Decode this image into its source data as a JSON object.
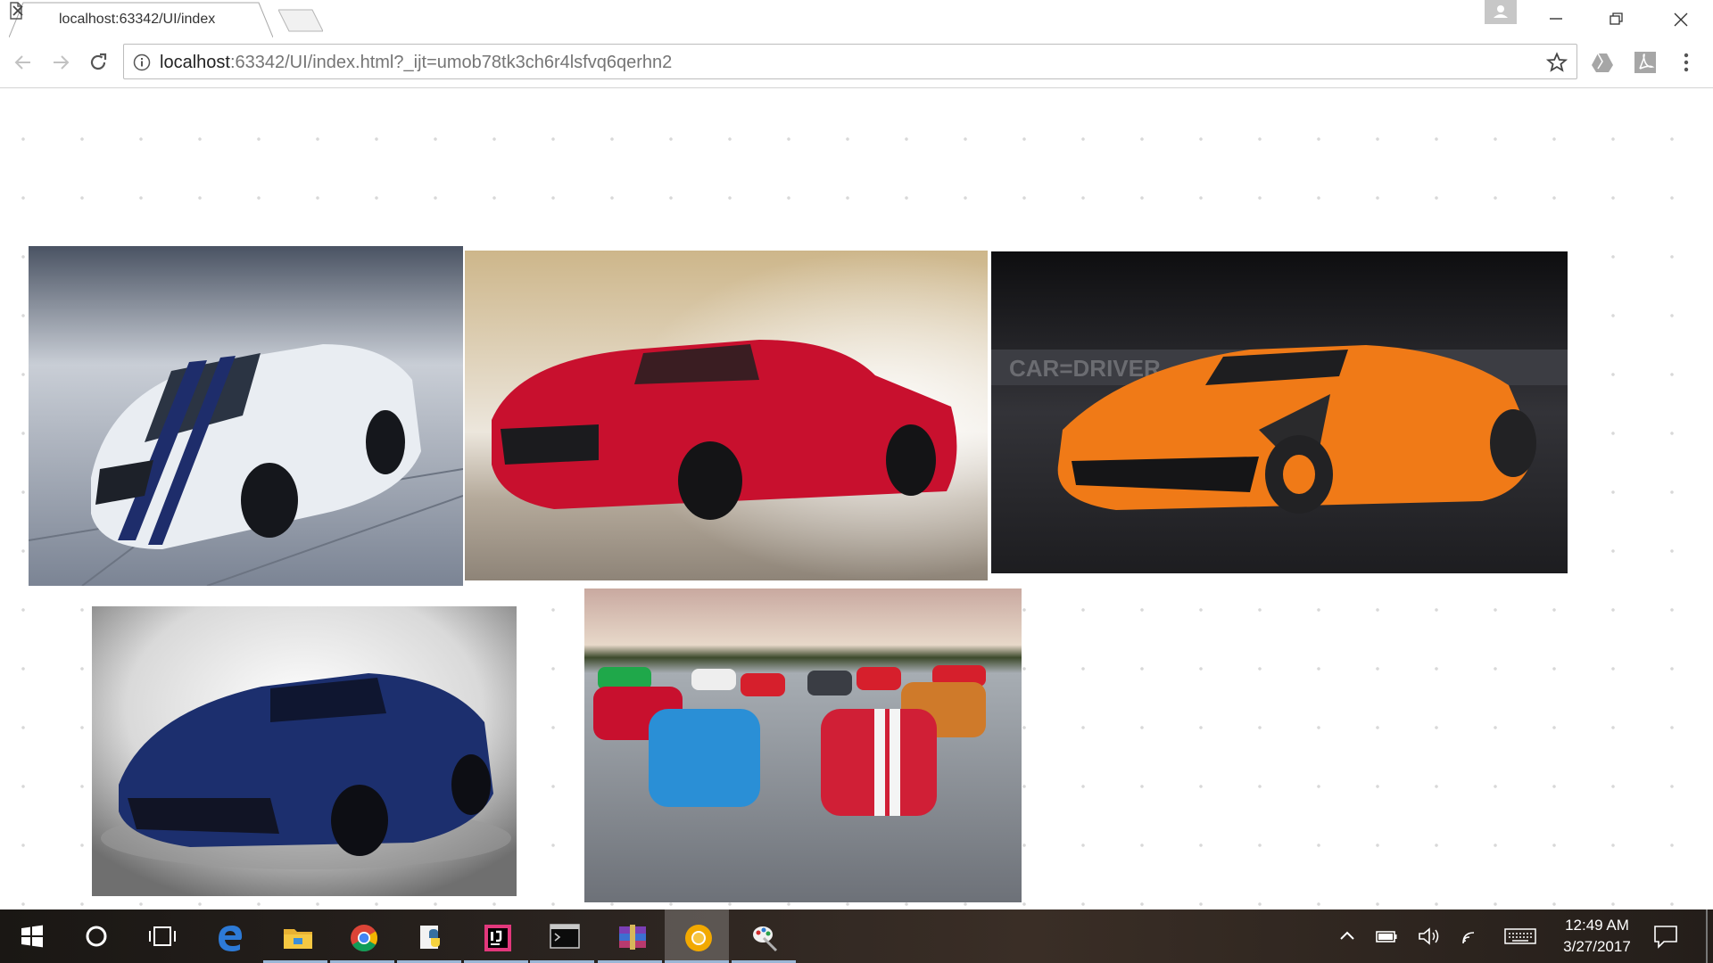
{
  "browser": {
    "tab_title": "localhost:63342/UI/index",
    "url_host": "localhost",
    "url_rest": ":63342/UI/index.html?_ijt=umob78tk3ch6r4lsfvq6qerhn2"
  },
  "page": {
    "images": [
      {
        "name": "white-mustang-gt350",
        "colors": {
          "body": "#e9edf2",
          "stripe": "#1e2d6b",
          "bg": "#7b8494"
        }
      },
      {
        "name": "red-mustang-burnout",
        "colors": {
          "body": "#c8102e",
          "bg": "#d9c9a8"
        }
      },
      {
        "name": "orange-supercar",
        "watermark": "CAR=DRIVER",
        "colors": {
          "body": "#f07a17",
          "bg": "#1d1d20"
        }
      },
      {
        "name": "blue-ford-gt",
        "colors": {
          "body": "#1c2f6e",
          "bg": "#d9d9d9"
        }
      },
      {
        "name": "car-group-lineup",
        "colors": {
          "bg": "#8a8f96"
        }
      }
    ]
  },
  "taskbar": {
    "apps": [
      "start-icon",
      "cortana-icon",
      "task-view-icon",
      "edge-icon",
      "file-explorer-icon",
      "chrome-icon",
      "python-icon",
      "intellij-icon",
      "terminal-icon",
      "winrar-icon",
      "chrome-canary-icon",
      "paint-icon"
    ],
    "time": "12:49 AM",
    "date": "3/27/2017"
  }
}
